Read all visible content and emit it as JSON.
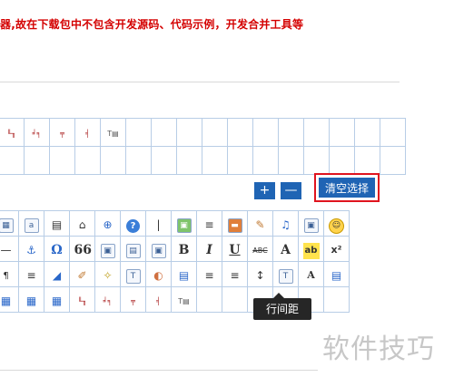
{
  "notice": "器,故在下载包中不包含开发源码、代码示例，开发合并工具等",
  "buttons": {
    "add": "+",
    "remove": "—",
    "clear": "清空选择"
  },
  "tooltip": "行间距",
  "watermark": "软件技巧",
  "top_grid_icons": [
    "╙╖",
    "╛╕",
    "╤",
    "╡",
    "T▤"
  ],
  "bottom_grid": {
    "row1": [
      "▦",
      "a",
      "▤",
      "⌂",
      "⊕",
      "?",
      "|",
      "▣",
      "≡",
      "▬",
      "✎",
      "♫",
      "▣",
      "☺"
    ],
    "row2": [
      "—",
      "⚓",
      "Ω",
      "66",
      "▣",
      "▤",
      "▣",
      "B",
      "I",
      "U",
      "ABC",
      "A",
      "ab",
      "x²"
    ],
    "row3": [
      "¶",
      "≡",
      "◢",
      "✐",
      "✧",
      "T",
      "◐",
      "▤",
      "≡",
      "≡",
      "↕",
      "T",
      "A",
      "▤"
    ],
    "row4": [
      "▦",
      "▦",
      "▦",
      "╙╖",
      "╛╕",
      "╤",
      "╡",
      "T▤"
    ]
  },
  "colors": {
    "accent": "#1f64b4",
    "highlight": "#e0141e",
    "notice": "#d40000",
    "grid": "#b8cde6"
  }
}
